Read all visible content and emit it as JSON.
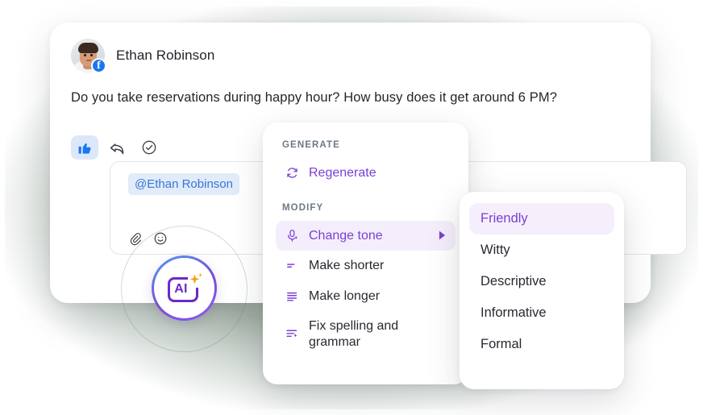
{
  "message": {
    "author_name": "Ethan Robinson",
    "avatar_alt": "user-photo",
    "source_badge": "facebook",
    "body": "Do you take reservations during happy hour? How busy does it get around 6 PM?"
  },
  "actions": [
    {
      "name": "like",
      "icon": "thumbs-up-icon",
      "active": true
    },
    {
      "name": "reply",
      "icon": "reply-arrow-icon",
      "active": false
    },
    {
      "name": "resolve",
      "icon": "check-circle-icon",
      "active": false
    }
  ],
  "composer": {
    "mention_chip": "@Ethan Robinson",
    "placeholder": "",
    "tools": [
      {
        "name": "attach",
        "icon": "paperclip-icon"
      },
      {
        "name": "emoji",
        "icon": "smiley-icon"
      }
    ]
  },
  "ai_button": {
    "label": "AI",
    "icon": "ai-sparkle-icon",
    "ring_colors": [
      "#4f9cf2",
      "#7b4ad6"
    ]
  },
  "menu": {
    "sections": [
      {
        "label": "GENERATE",
        "items": [
          {
            "label": "Regenerate",
            "icon": "refresh-icon",
            "accent": true,
            "active": false,
            "submenu": false
          }
        ]
      },
      {
        "label": "MODIFY",
        "items": [
          {
            "label": "Change tone",
            "icon": "microphone-sparkle-icon",
            "accent": true,
            "active": true,
            "submenu": true
          },
          {
            "label": "Make shorter",
            "icon": "shorten-lines-icon",
            "accent": false,
            "active": false,
            "submenu": false
          },
          {
            "label": "Make longer",
            "icon": "lengthen-lines-icon",
            "accent": false,
            "active": false,
            "submenu": false
          },
          {
            "label": "Fix spelling and grammar",
            "icon": "spellcheck-icon",
            "accent": false,
            "active": false,
            "submenu": false
          }
        ]
      }
    ]
  },
  "tone_submenu": {
    "options": [
      {
        "label": "Friendly",
        "selected": true
      },
      {
        "label": "Witty",
        "selected": false
      },
      {
        "label": "Descriptive",
        "selected": false
      },
      {
        "label": "Informative",
        "selected": false
      },
      {
        "label": "Formal",
        "selected": false
      }
    ]
  },
  "colors": {
    "accent_purple": "#7b3fd4",
    "accent_purple_deep": "#6d28c9",
    "highlight_bg": "#f4eefc",
    "facebook_blue": "#1877F2",
    "mention_blue": "#3576d8",
    "spark_orange": "#f59e0b",
    "backdrop": "#a9b5ab"
  }
}
